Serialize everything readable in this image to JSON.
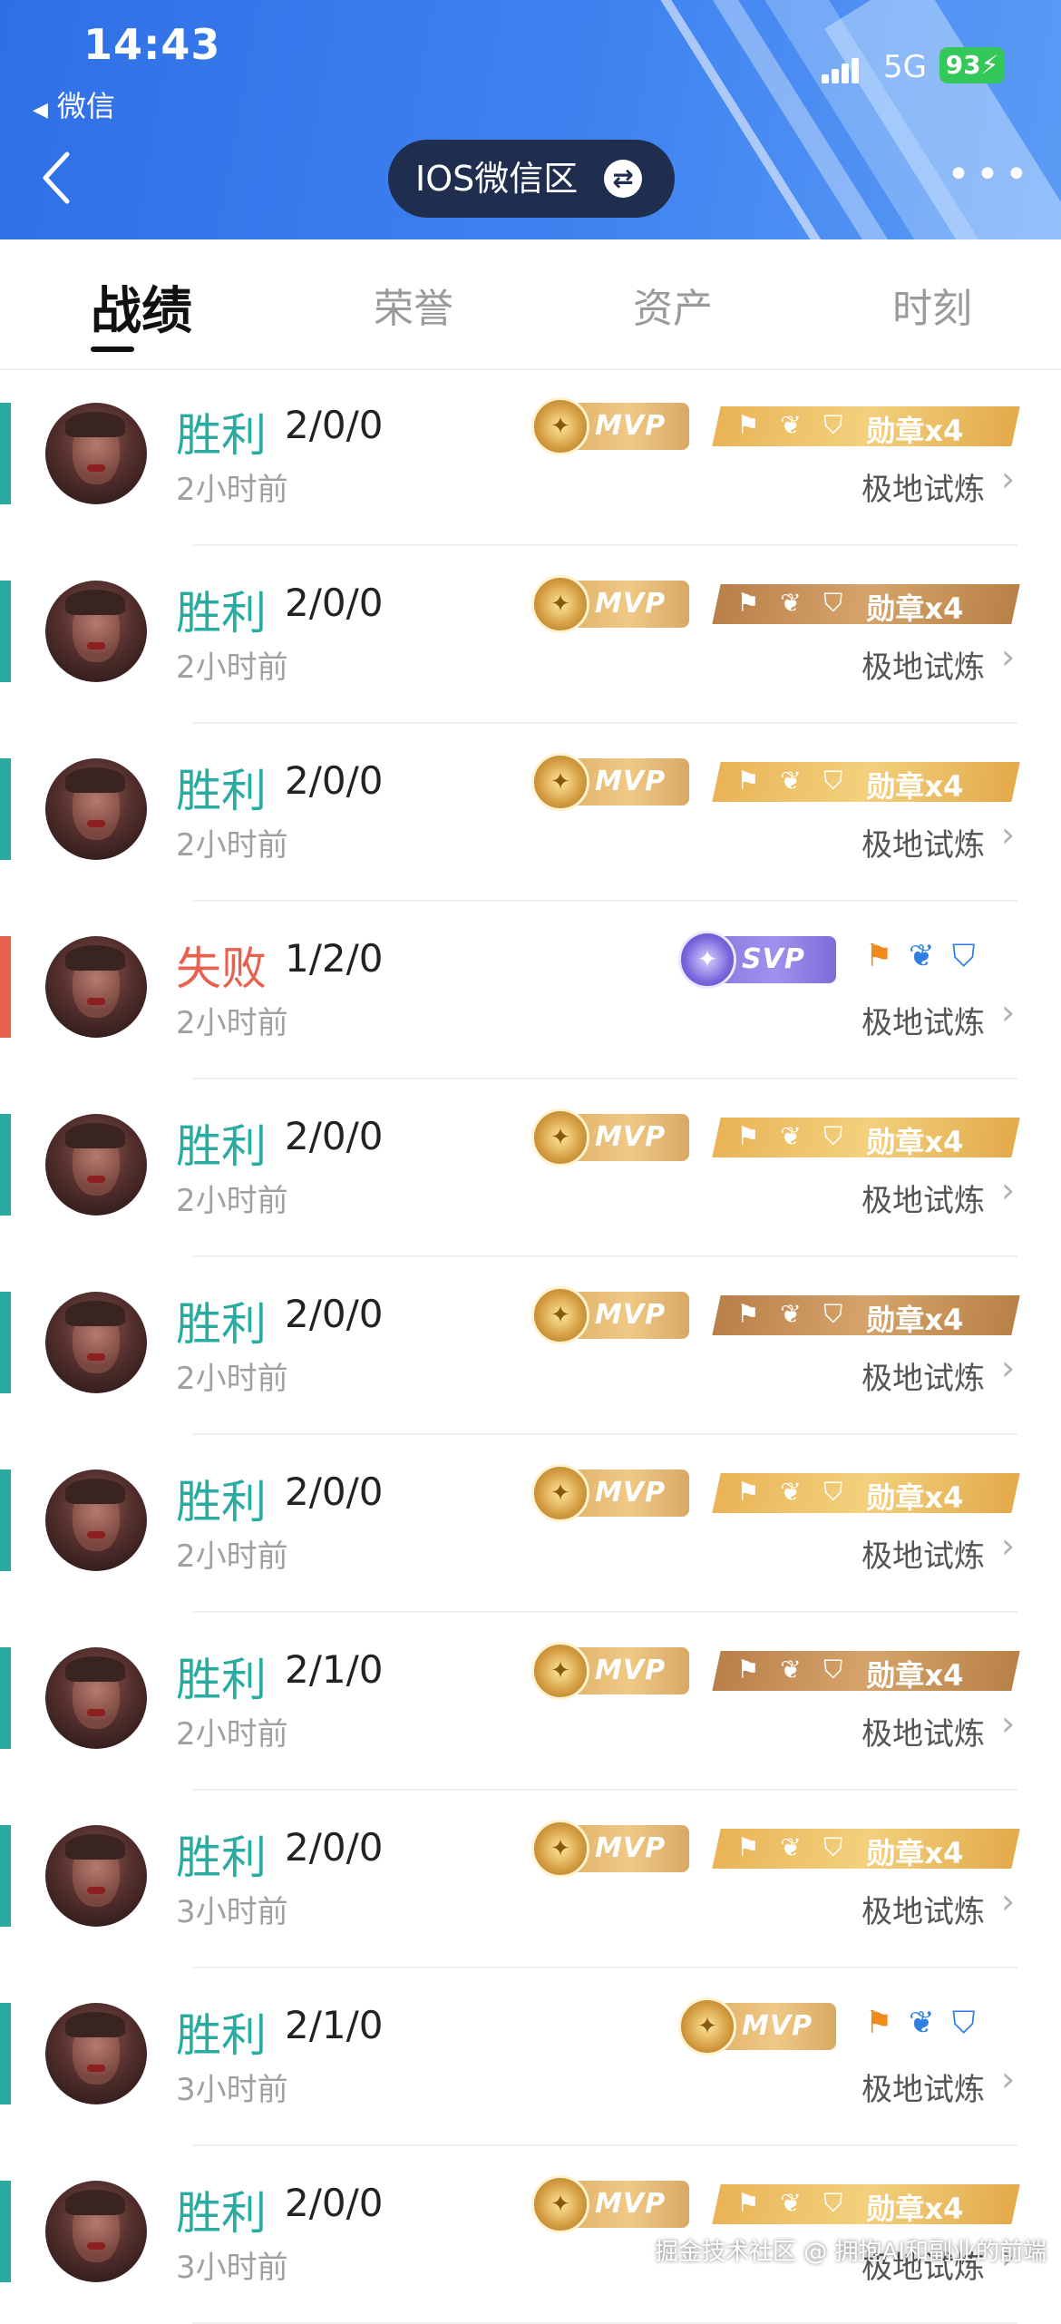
{
  "status_bar": {
    "time": "14:43",
    "back_app": "微信",
    "network": "5G",
    "battery": "93"
  },
  "nav": {
    "region": "IOS微信区"
  },
  "tabs": [
    {
      "label": "战绩",
      "active": true
    },
    {
      "label": "荣誉",
      "active": false
    },
    {
      "label": "资产",
      "active": false
    },
    {
      "label": "时刻",
      "active": false
    }
  ],
  "matches": [
    {
      "result": "胜利",
      "kda": "2/0/0",
      "ago": "2小时前",
      "mode": "极地试炼",
      "badge": "MVP",
      "medals": "勋章x4"
    },
    {
      "result": "胜利",
      "kda": "2/0/0",
      "ago": "2小时前",
      "mode": "极地试炼",
      "badge": "MVP",
      "medals": "勋章x4"
    },
    {
      "result": "胜利",
      "kda": "2/0/0",
      "ago": "2小时前",
      "mode": "极地试炼",
      "badge": "MVP",
      "medals": "勋章x4"
    },
    {
      "result": "失败",
      "kda": "1/2/0",
      "ago": "2小时前",
      "mode": "极地试炼",
      "badge": "SVP",
      "medals": ""
    },
    {
      "result": "胜利",
      "kda": "2/0/0",
      "ago": "2小时前",
      "mode": "极地试炼",
      "badge": "MVP",
      "medals": "勋章x4"
    },
    {
      "result": "胜利",
      "kda": "2/0/0",
      "ago": "2小时前",
      "mode": "极地试炼",
      "badge": "MVP",
      "medals": "勋章x4"
    },
    {
      "result": "胜利",
      "kda": "2/0/0",
      "ago": "2小时前",
      "mode": "极地试炼",
      "badge": "MVP",
      "medals": "勋章x4"
    },
    {
      "result": "胜利",
      "kda": "2/1/0",
      "ago": "2小时前",
      "mode": "极地试炼",
      "badge": "MVP",
      "medals": "勋章x4"
    },
    {
      "result": "胜利",
      "kda": "2/0/0",
      "ago": "3小时前",
      "mode": "极地试炼",
      "badge": "MVP",
      "medals": "勋章x4"
    },
    {
      "result": "胜利",
      "kda": "2/1/0",
      "ago": "3小时前",
      "mode": "极地试炼",
      "badge": "MVP",
      "medals": ""
    },
    {
      "result": "胜利",
      "kda": "2/0/0",
      "ago": "3小时前",
      "mode": "极地试炼",
      "badge": "MVP",
      "medals": "勋章x4"
    }
  ],
  "watermark": "掘金技术社区 @ 拥抱AI和副业的前端"
}
